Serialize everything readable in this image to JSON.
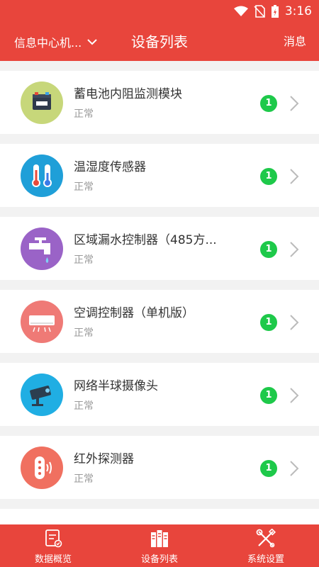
{
  "status_bar": {
    "time": "3:16"
  },
  "header": {
    "station": "信息中心机...",
    "title": "设备列表",
    "messages": "消息"
  },
  "devices": [
    {
      "name": "蓄电池内阻监测模块",
      "status": "正常",
      "count": "1",
      "icon": "battery-icon",
      "color": "#c7d77a"
    },
    {
      "name": "温湿度传感器",
      "status": "正常",
      "count": "1",
      "icon": "thermometer-icon",
      "color": "#1f9fd8"
    },
    {
      "name": "区域漏水控制器（485方...",
      "status": "正常",
      "count": "1",
      "icon": "faucet-icon",
      "color": "#9a63c7"
    },
    {
      "name": "空调控制器（单机版）",
      "status": "正常",
      "count": "1",
      "icon": "air-conditioner-icon",
      "color": "#ef7a76"
    },
    {
      "name": "网络半球摄像头",
      "status": "正常",
      "count": "1",
      "icon": "camera-icon",
      "color": "#20aee3"
    },
    {
      "name": "红外探测器",
      "status": "正常",
      "count": "1",
      "icon": "infrared-detector-icon",
      "color": "#f07060"
    }
  ],
  "tabs": [
    {
      "label": "数据概览",
      "icon": "overview-icon"
    },
    {
      "label": "设备列表",
      "icon": "device-list-icon"
    },
    {
      "label": "系统设置",
      "icon": "settings-tools-icon"
    }
  ],
  "colors": {
    "primary": "#e8453c",
    "badge": "#1ec94a"
  }
}
